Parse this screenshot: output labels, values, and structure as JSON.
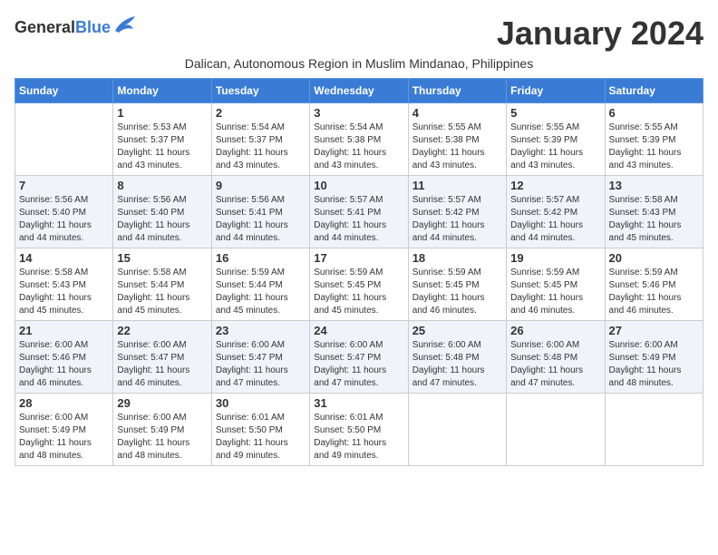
{
  "header": {
    "logo_general": "General",
    "logo_blue": "Blue",
    "month_title": "January 2024",
    "subtitle": "Dalican, Autonomous Region in Muslim Mindanao, Philippines"
  },
  "days_of_week": [
    "Sunday",
    "Monday",
    "Tuesday",
    "Wednesday",
    "Thursday",
    "Friday",
    "Saturday"
  ],
  "weeks": [
    [
      {
        "day": "",
        "info": ""
      },
      {
        "day": "1",
        "info": "Sunrise: 5:53 AM\nSunset: 5:37 PM\nDaylight: 11 hours\nand 43 minutes."
      },
      {
        "day": "2",
        "info": "Sunrise: 5:54 AM\nSunset: 5:37 PM\nDaylight: 11 hours\nand 43 minutes."
      },
      {
        "day": "3",
        "info": "Sunrise: 5:54 AM\nSunset: 5:38 PM\nDaylight: 11 hours\nand 43 minutes."
      },
      {
        "day": "4",
        "info": "Sunrise: 5:55 AM\nSunset: 5:38 PM\nDaylight: 11 hours\nand 43 minutes."
      },
      {
        "day": "5",
        "info": "Sunrise: 5:55 AM\nSunset: 5:39 PM\nDaylight: 11 hours\nand 43 minutes."
      },
      {
        "day": "6",
        "info": "Sunrise: 5:55 AM\nSunset: 5:39 PM\nDaylight: 11 hours\nand 43 minutes."
      }
    ],
    [
      {
        "day": "7",
        "info": "Sunrise: 5:56 AM\nSunset: 5:40 PM\nDaylight: 11 hours\nand 44 minutes."
      },
      {
        "day": "8",
        "info": "Sunrise: 5:56 AM\nSunset: 5:40 PM\nDaylight: 11 hours\nand 44 minutes."
      },
      {
        "day": "9",
        "info": "Sunrise: 5:56 AM\nSunset: 5:41 PM\nDaylight: 11 hours\nand 44 minutes."
      },
      {
        "day": "10",
        "info": "Sunrise: 5:57 AM\nSunset: 5:41 PM\nDaylight: 11 hours\nand 44 minutes."
      },
      {
        "day": "11",
        "info": "Sunrise: 5:57 AM\nSunset: 5:42 PM\nDaylight: 11 hours\nand 44 minutes."
      },
      {
        "day": "12",
        "info": "Sunrise: 5:57 AM\nSunset: 5:42 PM\nDaylight: 11 hours\nand 44 minutes."
      },
      {
        "day": "13",
        "info": "Sunrise: 5:58 AM\nSunset: 5:43 PM\nDaylight: 11 hours\nand 45 minutes."
      }
    ],
    [
      {
        "day": "14",
        "info": "Sunrise: 5:58 AM\nSunset: 5:43 PM\nDaylight: 11 hours\nand 45 minutes."
      },
      {
        "day": "15",
        "info": "Sunrise: 5:58 AM\nSunset: 5:44 PM\nDaylight: 11 hours\nand 45 minutes."
      },
      {
        "day": "16",
        "info": "Sunrise: 5:59 AM\nSunset: 5:44 PM\nDaylight: 11 hours\nand 45 minutes."
      },
      {
        "day": "17",
        "info": "Sunrise: 5:59 AM\nSunset: 5:45 PM\nDaylight: 11 hours\nand 45 minutes."
      },
      {
        "day": "18",
        "info": "Sunrise: 5:59 AM\nSunset: 5:45 PM\nDaylight: 11 hours\nand 46 minutes."
      },
      {
        "day": "19",
        "info": "Sunrise: 5:59 AM\nSunset: 5:45 PM\nDaylight: 11 hours\nand 46 minutes."
      },
      {
        "day": "20",
        "info": "Sunrise: 5:59 AM\nSunset: 5:46 PM\nDaylight: 11 hours\nand 46 minutes."
      }
    ],
    [
      {
        "day": "21",
        "info": "Sunrise: 6:00 AM\nSunset: 5:46 PM\nDaylight: 11 hours\nand 46 minutes."
      },
      {
        "day": "22",
        "info": "Sunrise: 6:00 AM\nSunset: 5:47 PM\nDaylight: 11 hours\nand 46 minutes."
      },
      {
        "day": "23",
        "info": "Sunrise: 6:00 AM\nSunset: 5:47 PM\nDaylight: 11 hours\nand 47 minutes."
      },
      {
        "day": "24",
        "info": "Sunrise: 6:00 AM\nSunset: 5:47 PM\nDaylight: 11 hours\nand 47 minutes."
      },
      {
        "day": "25",
        "info": "Sunrise: 6:00 AM\nSunset: 5:48 PM\nDaylight: 11 hours\nand 47 minutes."
      },
      {
        "day": "26",
        "info": "Sunrise: 6:00 AM\nSunset: 5:48 PM\nDaylight: 11 hours\nand 47 minutes."
      },
      {
        "day": "27",
        "info": "Sunrise: 6:00 AM\nSunset: 5:49 PM\nDaylight: 11 hours\nand 48 minutes."
      }
    ],
    [
      {
        "day": "28",
        "info": "Sunrise: 6:00 AM\nSunset: 5:49 PM\nDaylight: 11 hours\nand 48 minutes."
      },
      {
        "day": "29",
        "info": "Sunrise: 6:00 AM\nSunset: 5:49 PM\nDaylight: 11 hours\nand 48 minutes."
      },
      {
        "day": "30",
        "info": "Sunrise: 6:01 AM\nSunset: 5:50 PM\nDaylight: 11 hours\nand 49 minutes."
      },
      {
        "day": "31",
        "info": "Sunrise: 6:01 AM\nSunset: 5:50 PM\nDaylight: 11 hours\nand 49 minutes."
      },
      {
        "day": "",
        "info": ""
      },
      {
        "day": "",
        "info": ""
      },
      {
        "day": "",
        "info": ""
      }
    ]
  ]
}
